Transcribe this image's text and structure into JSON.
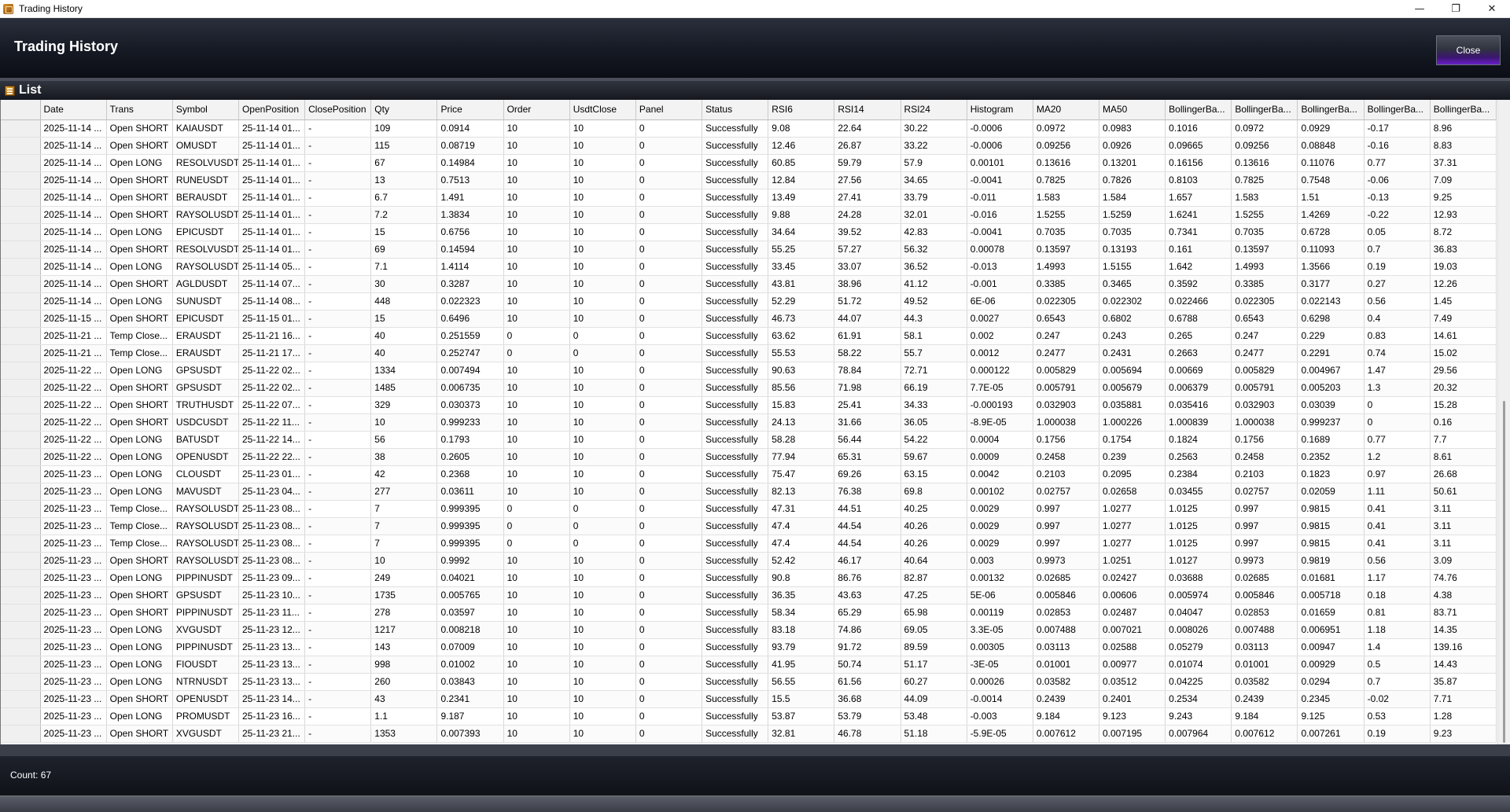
{
  "window": {
    "title": "Trading History",
    "minimize_glyph": "—",
    "restore_glyph": "❐",
    "close_glyph": "✕"
  },
  "header": {
    "title": "Trading History",
    "close_label": "Close"
  },
  "panel": {
    "title": "List"
  },
  "grid": {
    "columns": [
      "Date",
      "Trans",
      "Symbol",
      "OpenPosition",
      "ClosePosition",
      "Qty",
      "Price",
      "Order",
      "UsdtClose",
      "Panel",
      "Status",
      "RSI6",
      "RSI14",
      "RSI24",
      "Histogram",
      "MA20",
      "MA50",
      "BollingerBa...",
      "BollingerBa...",
      "BollingerBa...",
      "BollingerBa...",
      "BollingerBa..."
    ],
    "rows": [
      [
        "2025-11-14 ...",
        "Open SHORT",
        "KAIAUSDT",
        "25-11-14 01...",
        "-",
        "109",
        "0.0914",
        "10",
        "10",
        "0",
        "Successfully",
        "9.08",
        "22.64",
        "30.22",
        "-0.0006",
        "0.0972",
        "0.0983",
        "0.1016",
        "0.0972",
        "0.0929",
        "-0.17",
        "8.96"
      ],
      [
        "2025-11-14 ...",
        "Open SHORT",
        "OMUSDT",
        "25-11-14 01...",
        "-",
        "115",
        "0.08719",
        "10",
        "10",
        "0",
        "Successfully",
        "12.46",
        "26.87",
        "33.22",
        "-0.0006",
        "0.09256",
        "0.0926",
        "0.09665",
        "0.09256",
        "0.08848",
        "-0.16",
        "8.83"
      ],
      [
        "2025-11-14 ...",
        "Open LONG",
        "RESOLVUSDT",
        "25-11-14 01...",
        "-",
        "67",
        "0.14984",
        "10",
        "10",
        "0",
        "Successfully",
        "60.85",
        "59.79",
        "57.9",
        "0.00101",
        "0.13616",
        "0.13201",
        "0.16156",
        "0.13616",
        "0.11076",
        "0.77",
        "37.31"
      ],
      [
        "2025-11-14 ...",
        "Open SHORT",
        "RUNEUSDT",
        "25-11-14 01...",
        "-",
        "13",
        "0.7513",
        "10",
        "10",
        "0",
        "Successfully",
        "12.84",
        "27.56",
        "34.65",
        "-0.0041",
        "0.7825",
        "0.7826",
        "0.8103",
        "0.7825",
        "0.7548",
        "-0.06",
        "7.09"
      ],
      [
        "2025-11-14 ...",
        "Open SHORT",
        "BERAUSDT",
        "25-11-14 01...",
        "-",
        "6.7",
        "1.491",
        "10",
        "10",
        "0",
        "Successfully",
        "13.49",
        "27.41",
        "33.79",
        "-0.011",
        "1.583",
        "1.584",
        "1.657",
        "1.583",
        "1.51",
        "-0.13",
        "9.25"
      ],
      [
        "2025-11-14 ...",
        "Open SHORT",
        "RAYSOLUSDT",
        "25-11-14 01...",
        "-",
        "7.2",
        "1.3834",
        "10",
        "10",
        "0",
        "Successfully",
        "9.88",
        "24.28",
        "32.01",
        "-0.016",
        "1.5255",
        "1.5259",
        "1.6241",
        "1.5255",
        "1.4269",
        "-0.22",
        "12.93"
      ],
      [
        "2025-11-14 ...",
        "Open LONG",
        "EPICUSDT",
        "25-11-14 01...",
        "-",
        "15",
        "0.6756",
        "10",
        "10",
        "0",
        "Successfully",
        "34.64",
        "39.52",
        "42.83",
        "-0.0041",
        "0.7035",
        "0.7035",
        "0.7341",
        "0.7035",
        "0.6728",
        "0.05",
        "8.72"
      ],
      [
        "2025-11-14 ...",
        "Open SHORT",
        "RESOLVUSDT",
        "25-11-14 01...",
        "-",
        "69",
        "0.14594",
        "10",
        "10",
        "0",
        "Successfully",
        "55.25",
        "57.27",
        "56.32",
        "0.00078",
        "0.13597",
        "0.13193",
        "0.161",
        "0.13597",
        "0.11093",
        "0.7",
        "36.83"
      ],
      [
        "2025-11-14 ...",
        "Open LONG",
        "RAYSOLUSDT",
        "25-11-14 05...",
        "-",
        "7.1",
        "1.4114",
        "10",
        "10",
        "0",
        "Successfully",
        "33.45",
        "33.07",
        "36.52",
        "-0.013",
        "1.4993",
        "1.5155",
        "1.642",
        "1.4993",
        "1.3566",
        "0.19",
        "19.03"
      ],
      [
        "2025-11-14 ...",
        "Open SHORT",
        "AGLDUSDT",
        "25-11-14 07...",
        "-",
        "30",
        "0.3287",
        "10",
        "10",
        "0",
        "Successfully",
        "43.81",
        "38.96",
        "41.12",
        "-0.001",
        "0.3385",
        "0.3465",
        "0.3592",
        "0.3385",
        "0.3177",
        "0.27",
        "12.26"
      ],
      [
        "2025-11-14 ...",
        "Open LONG",
        "SUNUSDT",
        "25-11-14 08...",
        "-",
        "448",
        "0.022323",
        "10",
        "10",
        "0",
        "Successfully",
        "52.29",
        "51.72",
        "49.52",
        "6E-06",
        "0.022305",
        "0.022302",
        "0.022466",
        "0.022305",
        "0.022143",
        "0.56",
        "1.45"
      ],
      [
        "2025-11-15 ...",
        "Open SHORT",
        "EPICUSDT",
        "25-11-15 01...",
        "-",
        "15",
        "0.6496",
        "10",
        "10",
        "0",
        "Successfully",
        "46.73",
        "44.07",
        "44.3",
        "0.0027",
        "0.6543",
        "0.6802",
        "0.6788",
        "0.6543",
        "0.6298",
        "0.4",
        "7.49"
      ],
      [
        "2025-11-21 ...",
        "Temp Close...",
        "ERAUSDT",
        "25-11-21 16...",
        "-",
        "40",
        "0.251559",
        "0",
        "0",
        "0",
        "Successfully",
        "63.62",
        "61.91",
        "58.1",
        "0.002",
        "0.247",
        "0.243",
        "0.265",
        "0.247",
        "0.229",
        "0.83",
        "14.61"
      ],
      [
        "2025-11-21 ...",
        "Temp Close...",
        "ERAUSDT",
        "25-11-21 17...",
        "-",
        "40",
        "0.252747",
        "0",
        "0",
        "0",
        "Successfully",
        "55.53",
        "58.22",
        "55.7",
        "0.0012",
        "0.2477",
        "0.2431",
        "0.2663",
        "0.2477",
        "0.2291",
        "0.74",
        "15.02"
      ],
      [
        "2025-11-22 ...",
        "Open LONG",
        "GPSUSDT",
        "25-11-22 02...",
        "-",
        "1334",
        "0.007494",
        "10",
        "10",
        "0",
        "Successfully",
        "90.63",
        "78.84",
        "72.71",
        "0.000122",
        "0.005829",
        "0.005694",
        "0.00669",
        "0.005829",
        "0.004967",
        "1.47",
        "29.56"
      ],
      [
        "2025-11-22 ...",
        "Open SHORT",
        "GPSUSDT",
        "25-11-22 02...",
        "-",
        "1485",
        "0.006735",
        "10",
        "10",
        "0",
        "Successfully",
        "85.56",
        "71.98",
        "66.19",
        "7.7E-05",
        "0.005791",
        "0.005679",
        "0.006379",
        "0.005791",
        "0.005203",
        "1.3",
        "20.32"
      ],
      [
        "2025-11-22 ...",
        "Open SHORT",
        "TRUTHUSDT",
        "25-11-22 07...",
        "-",
        "329",
        "0.030373",
        "10",
        "10",
        "0",
        "Successfully",
        "15.83",
        "25.41",
        "34.33",
        "-0.000193",
        "0.032903",
        "0.035881",
        "0.035416",
        "0.032903",
        "0.03039",
        "0",
        "15.28"
      ],
      [
        "2025-11-22 ...",
        "Open SHORT",
        "USDCUSDT",
        "25-11-22 11...",
        "-",
        "10",
        "0.999233",
        "10",
        "10",
        "0",
        "Successfully",
        "24.13",
        "31.66",
        "36.05",
        "-8.9E-05",
        "1.000038",
        "1.000226",
        "1.000839",
        "1.000038",
        "0.999237",
        "0",
        "0.16"
      ],
      [
        "2025-11-22 ...",
        "Open LONG",
        "BATUSDT",
        "25-11-22 14...",
        "-",
        "56",
        "0.1793",
        "10",
        "10",
        "0",
        "Successfully",
        "58.28",
        "56.44",
        "54.22",
        "0.0004",
        "0.1756",
        "0.1754",
        "0.1824",
        "0.1756",
        "0.1689",
        "0.77",
        "7.7"
      ],
      [
        "2025-11-22 ...",
        "Open LONG",
        "OPENUSDT",
        "25-11-22 22...",
        "-",
        "38",
        "0.2605",
        "10",
        "10",
        "0",
        "Successfully",
        "77.94",
        "65.31",
        "59.67",
        "0.0009",
        "0.2458",
        "0.239",
        "0.2563",
        "0.2458",
        "0.2352",
        "1.2",
        "8.61"
      ],
      [
        "2025-11-23 ...",
        "Open LONG",
        "CLOUSDT",
        "25-11-23 01...",
        "-",
        "42",
        "0.2368",
        "10",
        "10",
        "0",
        "Successfully",
        "75.47",
        "69.26",
        "63.15",
        "0.0042",
        "0.2103",
        "0.2095",
        "0.2384",
        "0.2103",
        "0.1823",
        "0.97",
        "26.68"
      ],
      [
        "2025-11-23 ...",
        "Open LONG",
        "MAVUSDT",
        "25-11-23 04...",
        "-",
        "277",
        "0.03611",
        "10",
        "10",
        "0",
        "Successfully",
        "82.13",
        "76.38",
        "69.8",
        "0.00102",
        "0.02757",
        "0.02658",
        "0.03455",
        "0.02757",
        "0.02059",
        "1.11",
        "50.61"
      ],
      [
        "2025-11-23 ...",
        "Temp Close...",
        "RAYSOLUSDT",
        "25-11-23 08...",
        "-",
        "7",
        "0.999395",
        "0",
        "0",
        "0",
        "Successfully",
        "47.31",
        "44.51",
        "40.25",
        "0.0029",
        "0.997",
        "1.0277",
        "1.0125",
        "0.997",
        "0.9815",
        "0.41",
        "3.11"
      ],
      [
        "2025-11-23 ...",
        "Temp Close...",
        "RAYSOLUSDT",
        "25-11-23 08...",
        "-",
        "7",
        "0.999395",
        "0",
        "0",
        "0",
        "Successfully",
        "47.4",
        "44.54",
        "40.26",
        "0.0029",
        "0.997",
        "1.0277",
        "1.0125",
        "0.997",
        "0.9815",
        "0.41",
        "3.11"
      ],
      [
        "2025-11-23 ...",
        "Temp Close...",
        "RAYSOLUSDT",
        "25-11-23 08...",
        "-",
        "7",
        "0.999395",
        "0",
        "0",
        "0",
        "Successfully",
        "47.4",
        "44.54",
        "40.26",
        "0.0029",
        "0.997",
        "1.0277",
        "1.0125",
        "0.997",
        "0.9815",
        "0.41",
        "3.11"
      ],
      [
        "2025-11-23 ...",
        "Open SHORT",
        "RAYSOLUSDT",
        "25-11-23 08...",
        "-",
        "10",
        "0.9992",
        "10",
        "10",
        "0",
        "Successfully",
        "52.42",
        "46.17",
        "40.64",
        "0.003",
        "0.9973",
        "1.0251",
        "1.0127",
        "0.9973",
        "0.9819",
        "0.56",
        "3.09"
      ],
      [
        "2025-11-23 ...",
        "Open LONG",
        "PIPPINUSDT",
        "25-11-23 09...",
        "-",
        "249",
        "0.04021",
        "10",
        "10",
        "0",
        "Successfully",
        "90.8",
        "86.76",
        "82.87",
        "0.00132",
        "0.02685",
        "0.02427",
        "0.03688",
        "0.02685",
        "0.01681",
        "1.17",
        "74.76"
      ],
      [
        "2025-11-23 ...",
        "Open SHORT",
        "GPSUSDT",
        "25-11-23 10...",
        "-",
        "1735",
        "0.005765",
        "10",
        "10",
        "0",
        "Successfully",
        "36.35",
        "43.63",
        "47.25",
        "5E-06",
        "0.005846",
        "0.00606",
        "0.005974",
        "0.005846",
        "0.005718",
        "0.18",
        "4.38"
      ],
      [
        "2025-11-23 ...",
        "Open SHORT",
        "PIPPINUSDT",
        "25-11-23 11...",
        "-",
        "278",
        "0.03597",
        "10",
        "10",
        "0",
        "Successfully",
        "58.34",
        "65.29",
        "65.98",
        "0.00119",
        "0.02853",
        "0.02487",
        "0.04047",
        "0.02853",
        "0.01659",
        "0.81",
        "83.71"
      ],
      [
        "2025-11-23 ...",
        "Open LONG",
        "XVGUSDT",
        "25-11-23 12...",
        "-",
        "1217",
        "0.008218",
        "10",
        "10",
        "0",
        "Successfully",
        "83.18",
        "74.86",
        "69.05",
        "3.3E-05",
        "0.007488",
        "0.007021",
        "0.008026",
        "0.007488",
        "0.006951",
        "1.18",
        "14.35"
      ],
      [
        "2025-11-23 ...",
        "Open LONG",
        "PIPPINUSDT",
        "25-11-23 13...",
        "-",
        "143",
        "0.07009",
        "10",
        "10",
        "0",
        "Successfully",
        "93.79",
        "91.72",
        "89.59",
        "0.00305",
        "0.03113",
        "0.02588",
        "0.05279",
        "0.03113",
        "0.00947",
        "1.4",
        "139.16"
      ],
      [
        "2025-11-23 ...",
        "Open LONG",
        "FIOUSDT",
        "25-11-23 13...",
        "-",
        "998",
        "0.01002",
        "10",
        "10",
        "0",
        "Successfully",
        "41.95",
        "50.74",
        "51.17",
        "-3E-05",
        "0.01001",
        "0.00977",
        "0.01074",
        "0.01001",
        "0.00929",
        "0.5",
        "14.43"
      ],
      [
        "2025-11-23 ...",
        "Open LONG",
        "NTRNUSDT",
        "25-11-23 13...",
        "-",
        "260",
        "0.03843",
        "10",
        "10",
        "0",
        "Successfully",
        "56.55",
        "61.56",
        "60.27",
        "0.00026",
        "0.03582",
        "0.03512",
        "0.04225",
        "0.03582",
        "0.0294",
        "0.7",
        "35.87"
      ],
      [
        "2025-11-23 ...",
        "Open SHORT",
        "OPENUSDT",
        "25-11-23 14...",
        "-",
        "43",
        "0.2341",
        "10",
        "10",
        "0",
        "Successfully",
        "15.5",
        "36.68",
        "44.09",
        "-0.0014",
        "0.2439",
        "0.2401",
        "0.2534",
        "0.2439",
        "0.2345",
        "-0.02",
        "7.71"
      ],
      [
        "2025-11-23 ...",
        "Open LONG",
        "PROMUSDT",
        "25-11-23 16...",
        "-",
        "1.1",
        "9.187",
        "10",
        "10",
        "0",
        "Successfully",
        "53.87",
        "53.79",
        "53.48",
        "-0.003",
        "9.184",
        "9.123",
        "9.243",
        "9.184",
        "9.125",
        "0.53",
        "1.28"
      ],
      [
        "2025-11-23 ...",
        "Open SHORT",
        "XVGUSDT",
        "25-11-23 21...",
        "-",
        "1353",
        "0.007393",
        "10",
        "10",
        "0",
        "Successfully",
        "32.81",
        "46.78",
        "51.18",
        "-5.9E-05",
        "0.007612",
        "0.007195",
        "0.007964",
        "0.007612",
        "0.007261",
        "0.19",
        "9.23"
      ]
    ]
  },
  "footer": {
    "count_text": "Count: 67"
  },
  "colors": {
    "header_bg": "#151923",
    "close_button_accent": "#6a1fc8"
  }
}
